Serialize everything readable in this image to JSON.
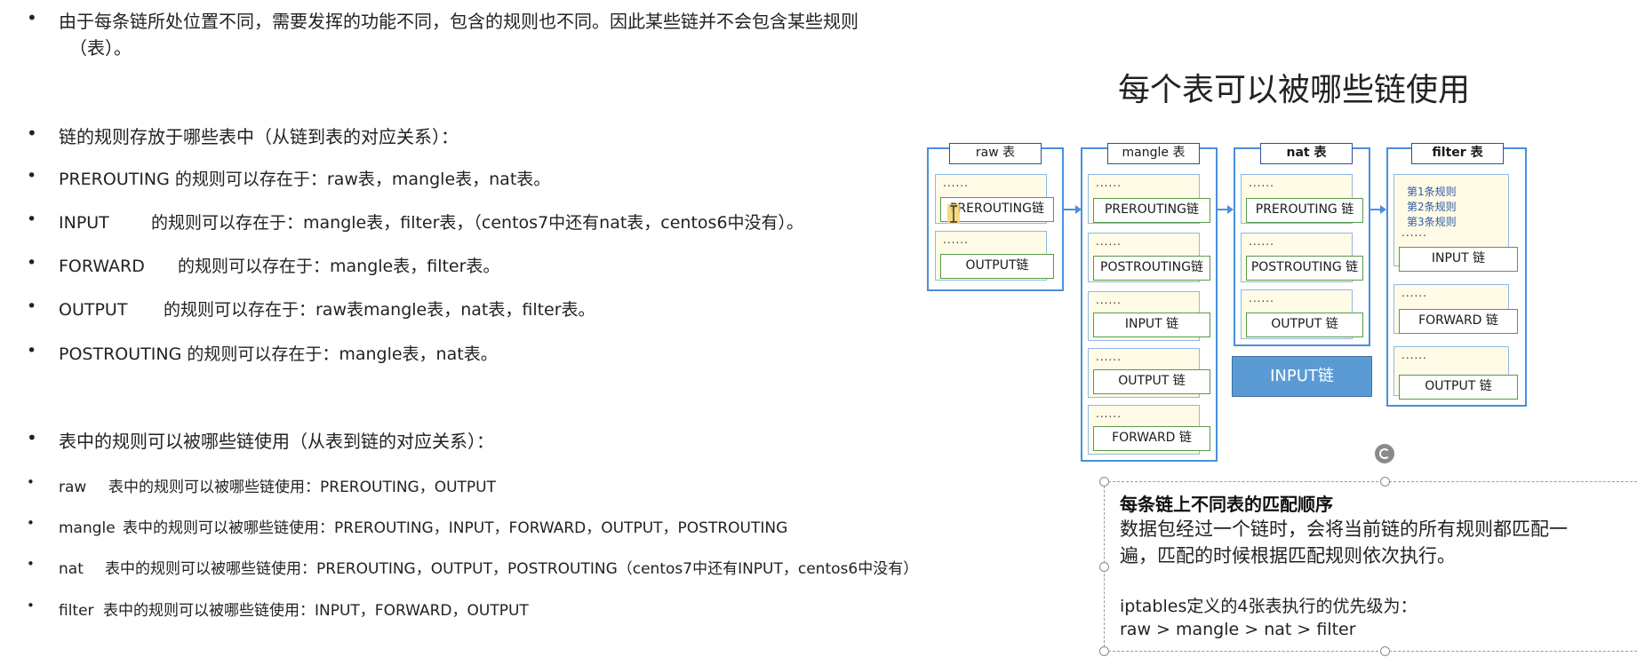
{
  "left": {
    "intro_line1": "由于每条链所处位置不同，需要发挥的功能不同，包含的规则也不同。因此某些链并不会包含某些规则",
    "intro_line2": "（表）。",
    "chain_to_table_heading": "链的规则存放于哪些表中（从链到表的对应关系）：",
    "chain_rules": [
      {
        "chain": "PREROUTING",
        "text": " 的规则可以存在于：raw表，mangle表，nat表。"
      },
      {
        "chain": "INPUT",
        "text": "的规则可以存在于：mangle表，filter表，（centos7中还有nat表，centos6中没有）。"
      },
      {
        "chain": "FORWARD",
        "text": "的规则可以存在于：mangle表，filter表。"
      },
      {
        "chain": "OUTPUT",
        "text": "的规则可以存在于：raw表mangle表，nat表，filter表。"
      },
      {
        "chain": "POSTROUTING",
        "text": " 的规则可以存在于：mangle表，nat表。"
      }
    ],
    "table_to_chain_heading": "表中的规则可以被哪些链使用（从表到链的对应关系）：",
    "table_rules": [
      {
        "table": "raw",
        "text": "表中的规则可以被哪些链使用：PREROUTING，OUTPUT"
      },
      {
        "table": "mangle",
        "text": "表中的规则可以被哪些链使用：PREROUTING，INPUT，FORWARD，OUTPUT，POSTROUTING"
      },
      {
        "table": "nat",
        "text": "表中的规则可以被哪些链使用：PREROUTING，OUTPUT，POSTROUTING（centos7中还有INPUT，centos6中没有）"
      },
      {
        "table": "filter",
        "text": "表中的规则可以被哪些链使用：INPUT，FORWARD，OUTPUT"
      }
    ],
    "bullet": "•"
  },
  "diagram": {
    "title": "每个表可以被哪些链使用",
    "dots": "......",
    "tables": [
      {
        "name": "raw 表",
        "chains": [
          "PREROUTING链",
          "OUTPUT链"
        ]
      },
      {
        "name": "mangle 表",
        "chains": [
          "PREROUTING链",
          "POSTROUTING链",
          "INPUT 链",
          "OUTPUT 链",
          "FORWARD 链"
        ]
      },
      {
        "name": "nat 表",
        "chains": [
          "PREROUTING 链",
          "POSTROUTING 链",
          "OUTPUT 链"
        ]
      },
      {
        "name": "filter 表",
        "chains": [
          "INPUT 链",
          "FORWARD 链",
          "OUTPUT 链"
        ]
      }
    ],
    "filter_rules": [
      "第1条规则",
      "第2条规则",
      "第3条规则"
    ],
    "input_button": "INPUT链"
  },
  "textbox": {
    "title": "每条链上不同表的匹配顺序",
    "line1": "数据包经过一个链时，会将当前链的所有规则都匹配一",
    "line2": "遍，匹配的时候根据匹配规则依次执行。",
    "line3": "iptables定义的4张表执行的优先级为：",
    "line4": "raw > mangle > nat > filter"
  },
  "colors": {
    "frame_blue": "#4a8fdd",
    "chain_green": "#5a9a4a",
    "chain_fill": "#fffbe6",
    "button_blue": "#5b9bd5"
  }
}
